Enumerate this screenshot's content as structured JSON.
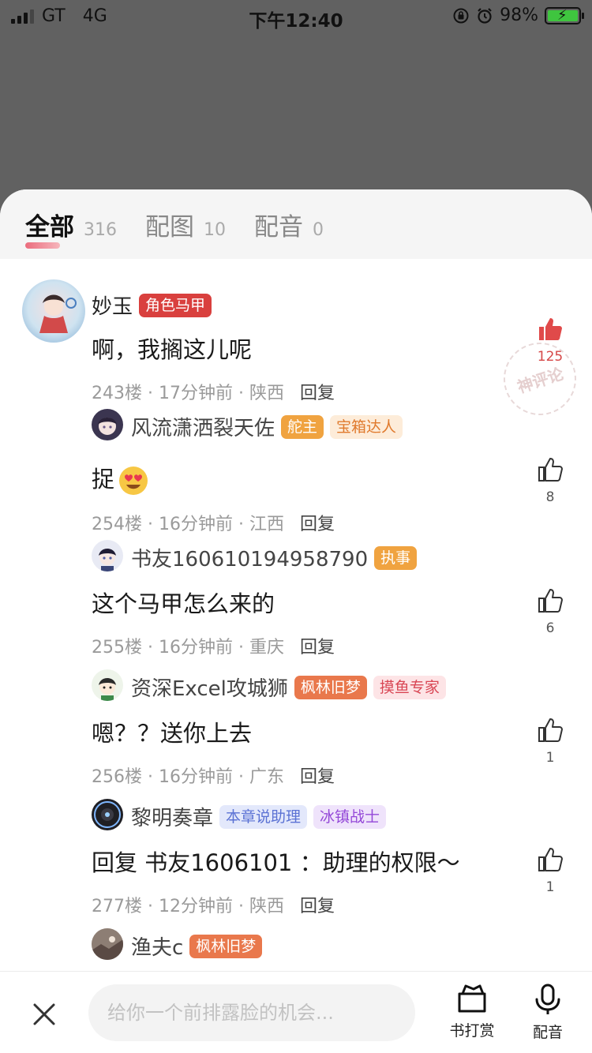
{
  "status_bar": {
    "carrier": "GT",
    "network": "4G",
    "time": "下午12:40",
    "battery": "98%"
  },
  "tabs": [
    {
      "label": "全部",
      "count": "316"
    },
    {
      "label": "配图",
      "count": "10"
    },
    {
      "label": "配音",
      "count": "0"
    }
  ],
  "comments": [
    {
      "name": "妙玉",
      "badges": [
        "角色马甲"
      ],
      "text": "啊，我搁这儿呢",
      "floor": "243楼",
      "time": "17分钟前",
      "location": "陕西",
      "reply": "回复",
      "likes": "125"
    },
    {
      "name": "风流潇洒裂天佐",
      "badges": [
        "舵主",
        "宝箱达人"
      ],
      "text": "捉",
      "floor": "254楼",
      "time": "16分钟前",
      "location": "江西",
      "reply": "回复",
      "likes": "8"
    },
    {
      "name": "书友160610194958790",
      "badges": [
        "执事"
      ],
      "text": "这个马甲怎么来的",
      "floor": "255楼",
      "time": "16分钟前",
      "location": "重庆",
      "reply": "回复",
      "likes": "6"
    },
    {
      "name": "资深Excel攻城狮",
      "badges": [
        "枫林旧梦",
        "摸鱼专家"
      ],
      "text": "嗯？？送你上去",
      "floor": "256楼",
      "time": "16分钟前",
      "location": "广东",
      "reply": "回复",
      "likes": "1"
    },
    {
      "name": "黎明奏章",
      "badges": [
        "本章说助理",
        "冰镇战士"
      ],
      "text": "回复 书友1606101 ：助理的权限～",
      "floor": "277楼",
      "time": "12分钟前",
      "location": "陕西",
      "reply": "回复",
      "likes": "1"
    },
    {
      "name": "渔夫c",
      "badges": [
        "枫林旧梦"
      ]
    }
  ],
  "seal_text": "神评论",
  "bottom": {
    "placeholder": "给你一个前排露脸的机会...",
    "tip_label": "书打赏",
    "voice_label": "配音"
  },
  "colors": {
    "accent": "#d9403e",
    "like_red": "#d64848"
  }
}
